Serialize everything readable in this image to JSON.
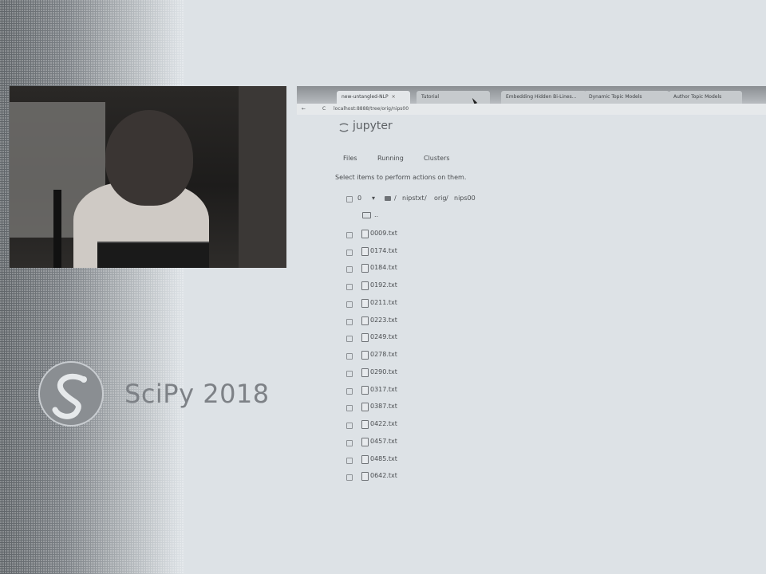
{
  "browser": {
    "tabs": [
      {
        "label": "new-untangled-NLP",
        "active": true
      },
      {
        "label": "Tutorial",
        "active": false
      },
      {
        "label": "Embedding Hidden Bi-Lines...",
        "active": false
      },
      {
        "label": "Dynamic Topic Models",
        "active": false
      },
      {
        "label": "Author Topic Models",
        "active": false
      }
    ],
    "tab_close": "×",
    "back": "←",
    "reload": "C",
    "url": "localhost:8888/tree/orig/nips00"
  },
  "jupyter": {
    "logo_text": "jupyter",
    "tabs": [
      "Files",
      "Running",
      "Clusters"
    ],
    "hint": "Select items to perform actions on them.",
    "selected_count": "0",
    "caret": "▾",
    "breadcrumb": [
      "nipstxt",
      "orig",
      "nips00"
    ],
    "breadcrumb_sep": "/",
    "parent_label": "..",
    "files": [
      "0009.txt",
      "0174.txt",
      "0184.txt",
      "0192.txt",
      "0211.txt",
      "0223.txt",
      "0249.txt",
      "0278.txt",
      "0290.txt",
      "0317.txt",
      "0387.txt",
      "0422.txt",
      "0457.txt",
      "0485.txt",
      "0642.txt"
    ]
  },
  "branding": {
    "conference": "SciPy 2018"
  },
  "colors": {
    "background": "#dde2e6",
    "text": "#4a4d50",
    "logo": "#7d8186"
  }
}
